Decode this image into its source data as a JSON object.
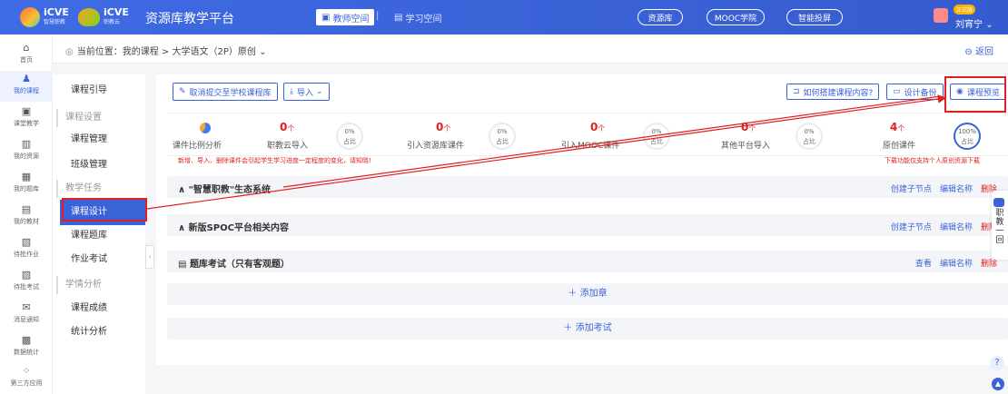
{
  "topbar": {
    "logo1": {
      "main": "iCVE",
      "sub": "智慧职教"
    },
    "logo2": {
      "main": "iCVE",
      "sub": "职教云"
    },
    "platform_title": "资源库教学平台",
    "teacher_space": "教师空间",
    "student_space": "学习空间",
    "pills": [
      "资源库",
      "MOOC学院",
      "智能投屏"
    ],
    "role_badge": "正式版",
    "user_name": "刘宵宁"
  },
  "left_nav": [
    {
      "label": "首页",
      "icon": "home-icon",
      "glyph": "⌂"
    },
    {
      "label": "我的课程",
      "icon": "course-icon",
      "glyph": "♟",
      "active": true
    },
    {
      "label": "课堂教学",
      "icon": "classroom-icon",
      "glyph": "▣"
    },
    {
      "label": "我的资源",
      "icon": "resource-icon",
      "glyph": "▥"
    },
    {
      "label": "我的题库",
      "icon": "question-bank-icon",
      "glyph": "▦"
    },
    {
      "label": "我的教材",
      "icon": "textbook-icon",
      "glyph": "▤"
    },
    {
      "label": "待批作业",
      "icon": "homework-icon",
      "glyph": "▧"
    },
    {
      "label": "待批考试",
      "icon": "exam-icon",
      "glyph": "▨"
    },
    {
      "label": "消息通知",
      "icon": "message-icon",
      "glyph": "✉"
    },
    {
      "label": "数据统计",
      "icon": "stats-icon",
      "glyph": "▩"
    },
    {
      "label": "第三方应用",
      "icon": "apps-icon",
      "glyph": "⁘"
    }
  ],
  "breadcrumb": {
    "text": "当前位置：我的课程 > 大学语文（2P）原创",
    "back": "返回"
  },
  "sub_nav": {
    "items": [
      {
        "type": "item",
        "label": "课程引导"
      },
      {
        "type": "group",
        "label": "课程设置"
      },
      {
        "type": "item",
        "label": "课程管理"
      },
      {
        "type": "item",
        "label": "班级管理"
      },
      {
        "type": "group",
        "label": "教学任务"
      },
      {
        "type": "item",
        "label": "课程设计",
        "active": true
      },
      {
        "type": "item",
        "label": "课程题库"
      },
      {
        "type": "item",
        "label": "作业考试"
      },
      {
        "type": "group",
        "label": "学情分析"
      },
      {
        "type": "item",
        "label": "课程成绩"
      },
      {
        "type": "item",
        "label": "统计分析"
      }
    ]
  },
  "toolbar": {
    "submit_label": "取消提交至学校课程库",
    "import_label": "导入",
    "how_build_label": "如何搭建课程内容?",
    "design_backup_label": "设计备份",
    "preview_label": "课程预览"
  },
  "stats": {
    "analysis_label": "课件比例分析",
    "items": [
      {
        "count": "0",
        "unit": "个",
        "label": "职教云导入",
        "pct": "0%",
        "pct_label": "占比"
      },
      {
        "count": "0",
        "unit": "个",
        "label": "引入资源库课件",
        "pct": "0%",
        "pct_label": "占比"
      },
      {
        "count": "0",
        "unit": "个",
        "label": "引入MOOC课件",
        "pct": "0%",
        "pct_label": "占比"
      },
      {
        "count": "0",
        "unit": "个",
        "label": "其他平台导入",
        "pct": "0%",
        "pct_label": "占比"
      },
      {
        "count": "4",
        "unit": "个",
        "label": "原创课件",
        "pct": "100%",
        "pct_label": "占比"
      }
    ]
  },
  "notice": {
    "left": "新增、导入、删除课件会引起学生学习进度一定程度的变化，请知晓!",
    "right": "下载功能仅支持个人原创资源下载"
  },
  "sections": [
    {
      "title": "\"智慧职教\"生态系统",
      "actions": [
        "创建子节点",
        "编辑名称",
        "删除"
      ]
    },
    {
      "title": "新版SPOC平台相关内容",
      "actions": [
        "创建子节点",
        "编辑名称",
        "删除"
      ]
    },
    {
      "title": "题库考试（只有客观题）",
      "actions": [
        "查看",
        "编辑名称",
        "删除"
      ]
    }
  ],
  "add_chapter": "添加章",
  "add_exam": "添加考试",
  "float_bar": {
    "label": "职教一回"
  },
  "accent_color": "#3b63d8",
  "alert_color": "#e02020"
}
